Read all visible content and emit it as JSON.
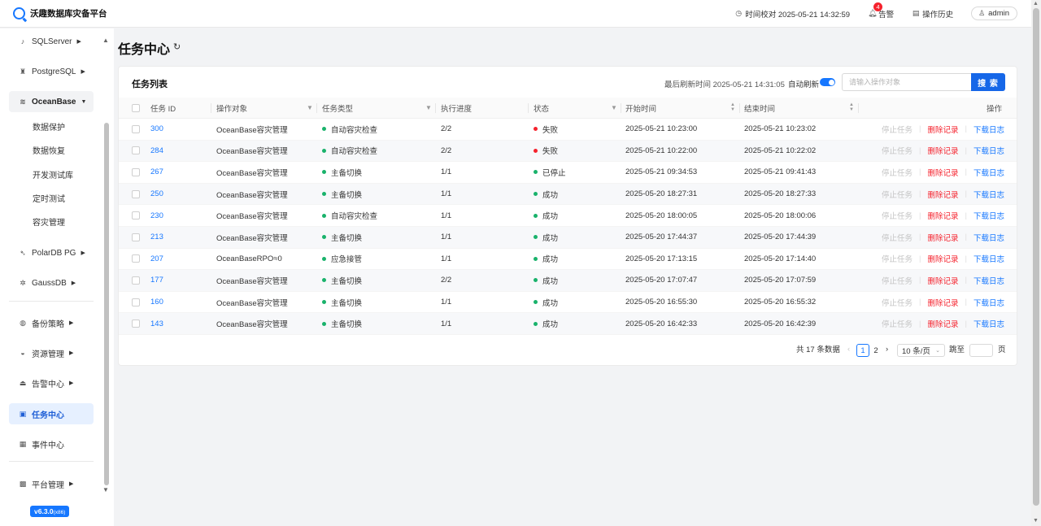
{
  "app": {
    "title": "沃趣数据库灾备平台"
  },
  "topbar": {
    "time_sync": "时间校对 2025-05-21 14:32:59",
    "alerts_label": "告警",
    "alerts_count": "4",
    "history_label": "操作历史",
    "user": "admin"
  },
  "sidebar": {
    "items": [
      {
        "label": "SQLServer",
        "icon": "sqlserver-icon"
      },
      {
        "label": "PostgreSQL",
        "icon": "postgresql-icon"
      },
      {
        "label": "OceanBase",
        "icon": "oceanbase-icon"
      },
      {
        "label": "PolarDB PG",
        "icon": "polardb-icon"
      },
      {
        "label": "GaussDB",
        "icon": "gaussdb-icon"
      },
      {
        "label": "备份策略",
        "icon": "backup-policy-icon"
      },
      {
        "label": "资源管理",
        "icon": "resource-icon"
      },
      {
        "label": "告警中心",
        "icon": "alarm-icon"
      },
      {
        "label": "任务中心",
        "icon": "task-icon"
      },
      {
        "label": "事件中心",
        "icon": "event-icon"
      },
      {
        "label": "平台管理",
        "icon": "platform-icon"
      }
    ],
    "oceanbase_sub": [
      "数据保护",
      "数据恢复",
      "开发测试库",
      "定时测试",
      "容灾管理"
    ],
    "version": "v6.3.0",
    "arch": "(x86)"
  },
  "page": {
    "title": "任务中心"
  },
  "card": {
    "title": "任务列表",
    "last_refresh": "最后刷新时间 2025-05-21 14:31:05",
    "auto_refresh_label": "自动刷新",
    "auto_refresh_on": true,
    "search_placeholder": "请输入操作对象",
    "search_button": "搜 索"
  },
  "table": {
    "headers": [
      "任务 ID",
      "操作对象",
      "任务类型",
      "执行进度",
      "状态",
      "开始时间",
      "结束时间",
      "操作"
    ],
    "actions": [
      "停止任务",
      "删除记录",
      "下载日志"
    ],
    "rows": [
      {
        "id": "300",
        "object": "OceanBase容灾管理",
        "type": "自动容灾检查",
        "progress": "2/2",
        "status": "失败",
        "status_color": "#f5222d",
        "start": "2025-05-21 10:23:00",
        "end": "2025-05-21 10:23:02"
      },
      {
        "id": "284",
        "object": "OceanBase容灾管理",
        "type": "自动容灾检查",
        "progress": "2/2",
        "status": "失败",
        "status_color": "#f5222d",
        "start": "2025-05-21 10:22:00",
        "end": "2025-05-21 10:22:02"
      },
      {
        "id": "267",
        "object": "OceanBase容灾管理",
        "type": "主备切换",
        "progress": "1/1",
        "status": "已停止",
        "status_color": "#19b26b",
        "start": "2025-05-21 09:34:53",
        "end": "2025-05-21 09:41:43"
      },
      {
        "id": "250",
        "object": "OceanBase容灾管理",
        "type": "主备切换",
        "progress": "1/1",
        "status": "成功",
        "status_color": "#19b26b",
        "start": "2025-05-20 18:27:31",
        "end": "2025-05-20 18:27:33"
      },
      {
        "id": "230",
        "object": "OceanBase容灾管理",
        "type": "自动容灾检查",
        "progress": "1/1",
        "status": "成功",
        "status_color": "#19b26b",
        "start": "2025-05-20 18:00:05",
        "end": "2025-05-20 18:00:06"
      },
      {
        "id": "213",
        "object": "OceanBase容灾管理",
        "type": "主备切换",
        "progress": "1/1",
        "status": "成功",
        "status_color": "#19b26b",
        "start": "2025-05-20 17:44:37",
        "end": "2025-05-20 17:44:39"
      },
      {
        "id": "207",
        "object": "OceanBaseRPO≈0",
        "type": "应急接管",
        "progress": "1/1",
        "status": "成功",
        "status_color": "#19b26b",
        "start": "2025-05-20 17:13:15",
        "end": "2025-05-20 17:14:40"
      },
      {
        "id": "177",
        "object": "OceanBase容灾管理",
        "type": "主备切换",
        "progress": "2/2",
        "status": "成功",
        "status_color": "#19b26b",
        "start": "2025-05-20 17:07:47",
        "end": "2025-05-20 17:07:59"
      },
      {
        "id": "160",
        "object": "OceanBase容灾管理",
        "type": "主备切换",
        "progress": "1/1",
        "status": "成功",
        "status_color": "#19b26b",
        "start": "2025-05-20 16:55:30",
        "end": "2025-05-20 16:55:32"
      },
      {
        "id": "143",
        "object": "OceanBase容灾管理",
        "type": "主备切换",
        "progress": "1/1",
        "status": "成功",
        "status_color": "#19b26b",
        "start": "2025-05-20 16:42:33",
        "end": "2025-05-20 16:42:39"
      }
    ]
  },
  "pagination": {
    "total": "共 17 条数据",
    "pages": [
      "1",
      "2"
    ],
    "current": "1",
    "page_size": "10 条/页",
    "jump_label": "跳至",
    "page_suffix": "页"
  },
  "colors": {
    "primary": "#1677ff",
    "danger": "#f5222d",
    "success": "#19b26b",
    "type_dot": "#19b26b"
  }
}
